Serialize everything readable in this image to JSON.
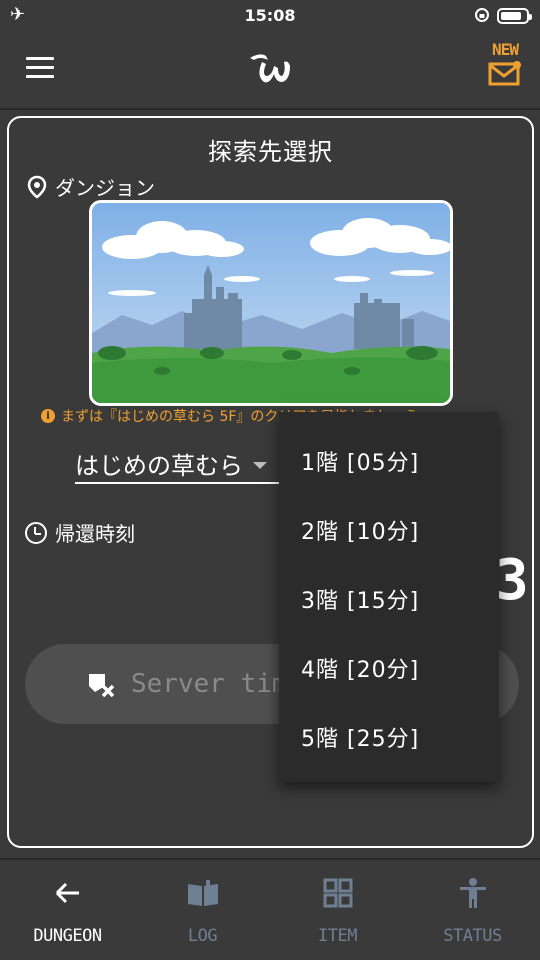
{
  "status_bar": {
    "time": "15:08"
  },
  "header": {
    "new_badge": "NEW"
  },
  "card": {
    "title": "探索先選択",
    "dungeon_label": "ダンジョン",
    "notice": "まずは『はじめの草むら 5F』のクリアを目指しましょう",
    "selected_dungeon": "はじめの草むら",
    "return_time_label": "帰還時刻",
    "time_partial": "3",
    "server_button": "Server time"
  },
  "dropdown": {
    "options": [
      "1階 [05分]",
      "2階 [10分]",
      "3階 [15分]",
      "4階 [20分]",
      "5階 [25分]"
    ]
  },
  "bottom_nav": {
    "items": [
      {
        "label": "DUNGEON",
        "icon": "arrow-left-icon",
        "active": true
      },
      {
        "label": "LOG",
        "icon": "book-icon",
        "active": false
      },
      {
        "label": "ITEM",
        "icon": "grid-icon",
        "active": false
      },
      {
        "label": "STATUS",
        "icon": "person-icon",
        "active": false
      }
    ]
  },
  "colors": {
    "background": "#3a3a3a",
    "accent": "#f0a030",
    "inactive_nav": "#6f7f93",
    "dropdown_bg": "#2b2b2b"
  }
}
